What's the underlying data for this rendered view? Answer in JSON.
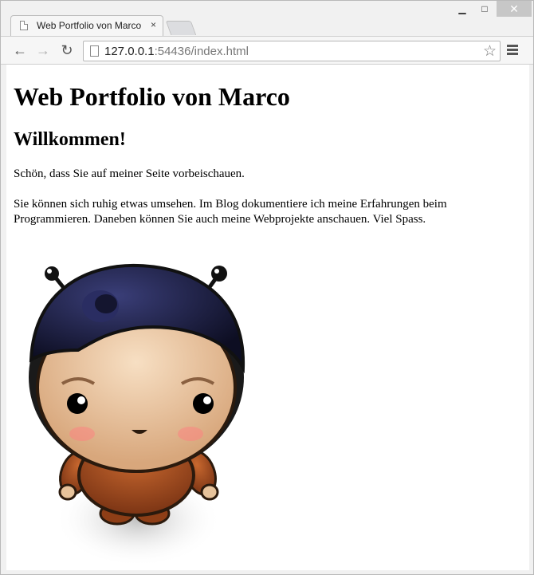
{
  "browser": {
    "tab": {
      "title": "Web Portfolio von Marco",
      "close": "×"
    },
    "window_controls": {
      "minimize": "▁",
      "maximize": "□",
      "close": "✕"
    },
    "nav": {
      "back": "←",
      "forward": "→",
      "reload": "↻",
      "menu_icon": "menu-icon"
    },
    "url": {
      "host": "127.0.0.1",
      "rest": ":54436/index.html"
    },
    "star": "☆"
  },
  "page": {
    "h1": "Web Portfolio von Marco",
    "h2": "Willkommen!",
    "p1": "Schön, dass Sie auf meiner Seite vorbeischauen.",
    "p2": "Sie können sich ruhig etwas umsehen. Im Blog dokumentiere ich meine Erfahrungen beim Programmieren. Daneben können Sie auch meine Webprojekte anschauen. Viel Spass."
  },
  "image": {
    "name": "mascot-illustration"
  }
}
